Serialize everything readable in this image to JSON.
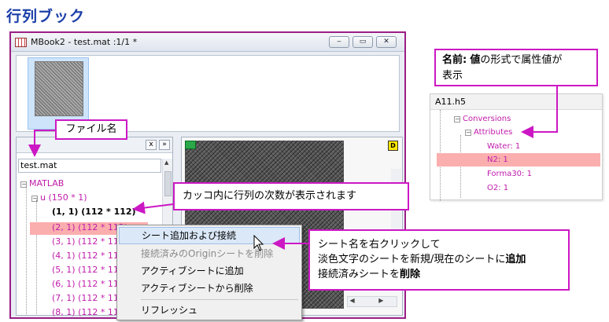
{
  "page": {
    "title": "行列ブック"
  },
  "window": {
    "title": "MBook2 - test.mat :1/1  *",
    "buttons": {
      "minimize": "‒",
      "restore": "▭",
      "close": "✕"
    },
    "thumbnail_label": "1"
  },
  "left_pane": {
    "close_label": "x",
    "expand_label": "»",
    "path": "test.mat",
    "tree": {
      "root": "MATLAB",
      "var": "u (150 * 1)",
      "items": [
        "(1, 1) (112 * 112)",
        "(2, 1) (112 * 112)",
        "(3, 1) (112 * 112)",
        "(4, 1) (112 * 112)",
        "(5, 1) (112 * 112)",
        "(6, 1) (112 * 112)",
        "(7, 1) (112 * 112)",
        "(8, 1) (112 * 112)"
      ]
    }
  },
  "right_pane": {
    "d_label": "D"
  },
  "context_menu": {
    "items": [
      "シート追加および接続",
      "接続済みのOriginシートを削除",
      "アクティブシートに追加",
      "アクティブシートから削除",
      "リフレッシュ"
    ]
  },
  "callouts": {
    "filename": "ファイル名",
    "paren": "カッコ内に行列の次数が表示されます",
    "sheet_line1": "シート名を右クリックして",
    "sheet_line2_pre": "淡色文字のシートを新規/現在のシートに",
    "sheet_line2_bold": "追加",
    "sheet_line3_pre": "接続済みシートを",
    "sheet_line3_bold": "削除",
    "attr_bold1": "名前:",
    "attr_bold2": "値",
    "attr_rest": "の形式で属性値が",
    "attr_line2": "表示"
  },
  "h5_panel": {
    "title": "A11.h5",
    "items": [
      "Conversions",
      "Attributes",
      "Water: 1",
      "N2: 1",
      "Forma30: 1",
      "O2: 1"
    ]
  },
  "colors": {
    "accent": "#cc18c4",
    "title_blue": "#1c3fa8",
    "highlight": "#fbaeae",
    "tree_magenta": "#c01cab"
  }
}
